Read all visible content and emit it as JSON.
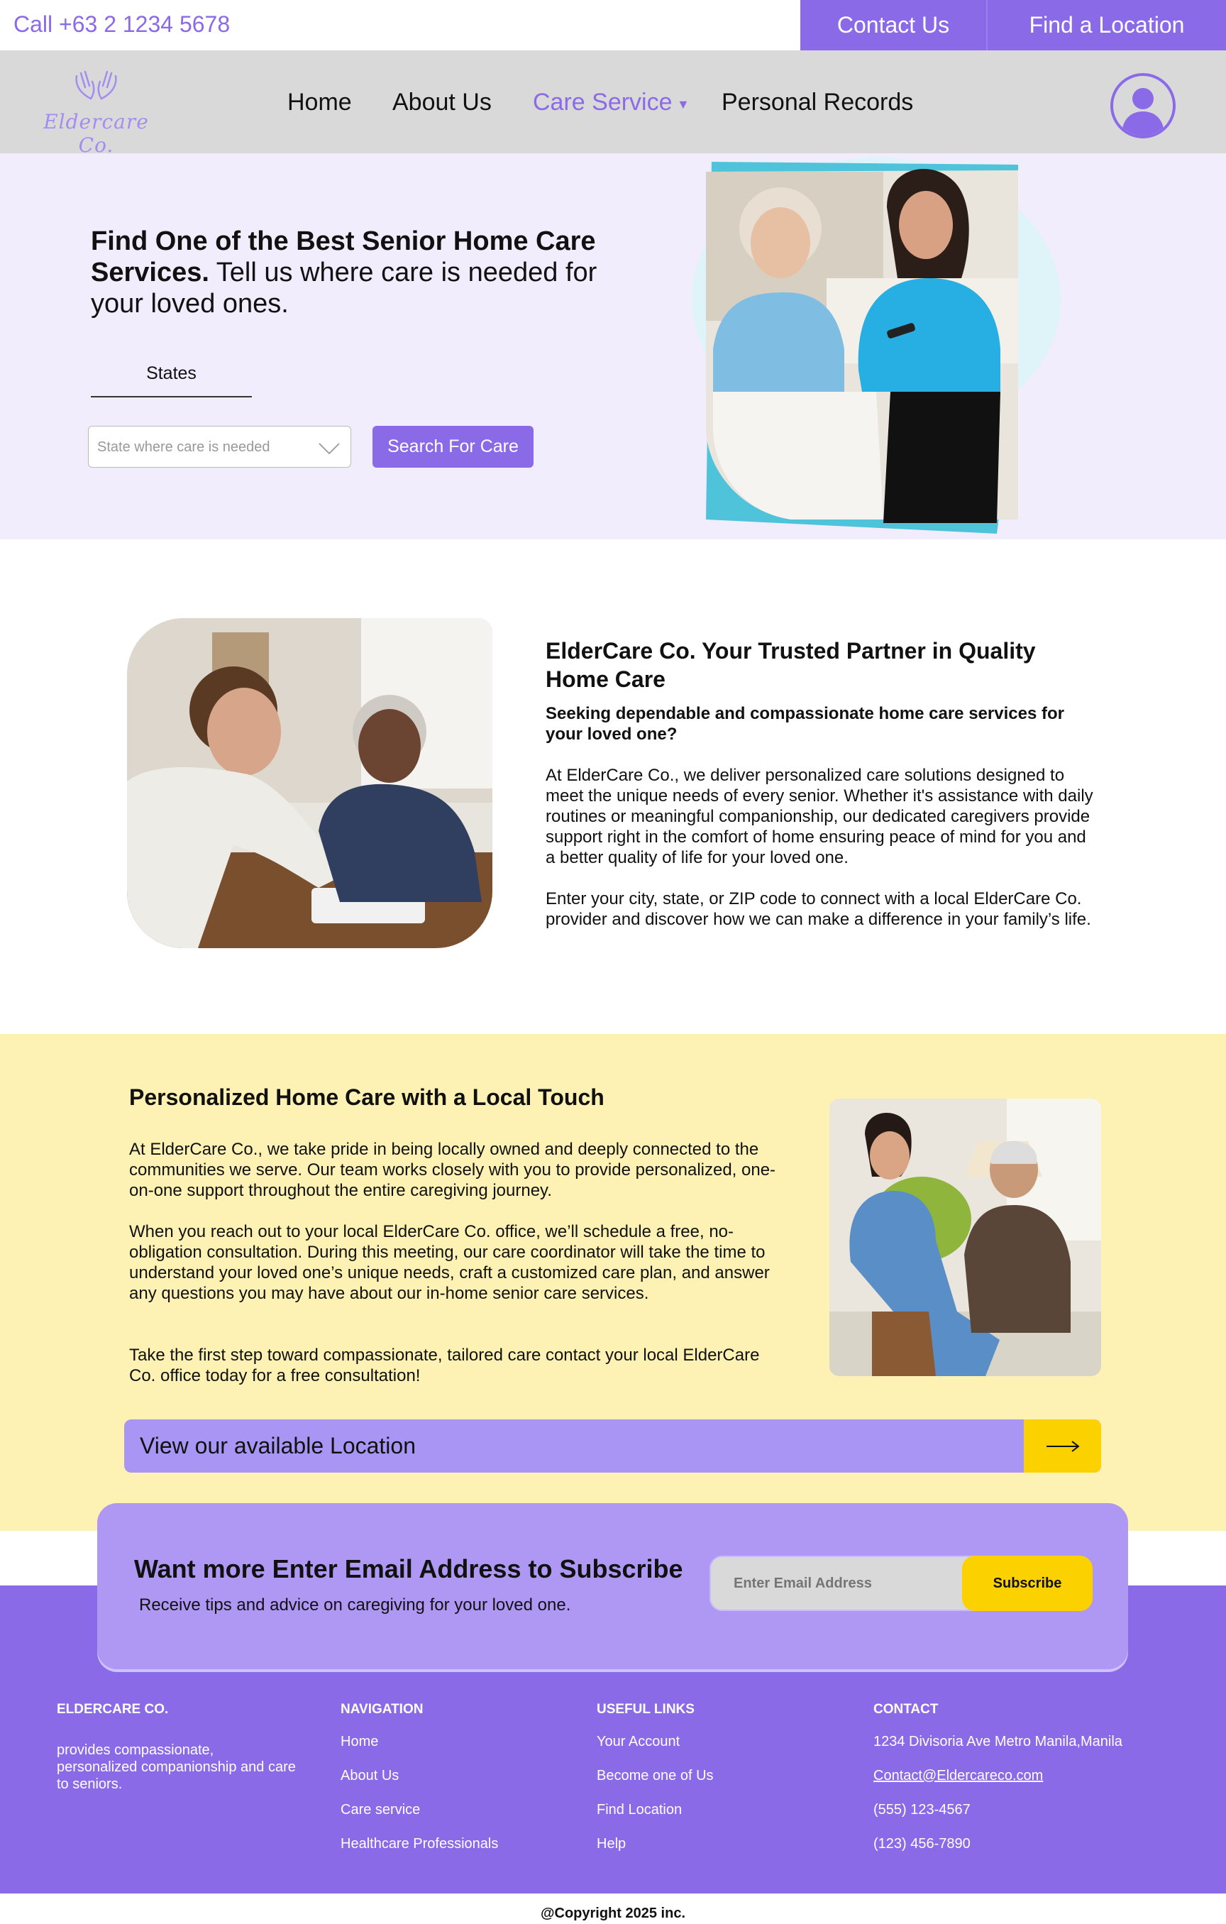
{
  "topbar": {
    "phone": "Call +63 2 1234 5678",
    "contact_label": "Contact Us",
    "location_label": "Find a Location"
  },
  "nav": {
    "logo_text": "Eldercare Co.",
    "links": [
      "Home",
      "About Us",
      "Care Service",
      "Personal Records"
    ],
    "active": "Care Service"
  },
  "hero": {
    "title_bold": "Find One of the Best Senior Home Care Services.",
    "title_rest": " Tell us where care is needed for your loved ones.",
    "tab_label": "States",
    "select_placeholder": "State where care is needed",
    "search_label": "Search For Care"
  },
  "about": {
    "title": "ElderCare Co. Your Trusted Partner in Quality Home Care",
    "subtitle": "Seeking dependable and compassionate home care services for your loved one?",
    "p1": "At ElderCare Co., we deliver personalized care solutions designed to meet the unique needs of every senior. Whether it's assistance with daily routines or meaningful companionship, our dedicated caregivers provide support right in the comfort of home ensuring peace of mind for you and a better quality of life for your loved one.",
    "p2": "Enter your city, state, or ZIP code to connect with a local ElderCare Co. provider and discover how we can make a difference in your family’s life."
  },
  "local": {
    "title": "Personalized Home Care with a Local Touch",
    "p1": "At ElderCare Co., we take pride in being locally owned and deeply connected to the communities we serve. Our team works closely with you to provide personalized, one-on-one support throughout the entire caregiving journey.",
    "p2": "When you reach out to your local ElderCare Co. office, we’ll schedule a free, no-obligation consultation. During this meeting, our care coordinator will take the time to understand your loved one’s unique needs, craft a customized care plan, and answer any questions you may have about our in-home senior care services.",
    "p3": "Take the first step toward compassionate, tailored care contact your local ElderCare Co. office today for a free consultation!",
    "location_bar_label": "View our available Location"
  },
  "subscribe": {
    "title": "Want more Enter Email Address to Subscribe",
    "text": "Receive tips and advice on caregiving for your loved one.",
    "placeholder": "Enter Email Address",
    "button": "Subscribe"
  },
  "footer": {
    "company_head": "ELDERCARE CO.",
    "company_desc": "provides compassionate, personalized companionship and care to seniors.",
    "nav_head": "NAVIGATION",
    "nav_links": [
      "Home",
      "About Us",
      "Care service",
      "Healthcare Professionals"
    ],
    "useful_head": "USEFUL LINKS",
    "useful_links": [
      "Your Account",
      "Become one of Us",
      "Find Location",
      "Help"
    ],
    "contact_head": "CONTACT",
    "address": "1234 Divisoria Ave Metro Manila,Manila",
    "email": "Contact@Eldercareco.com",
    "phone1": "(555) 123-4567",
    "phone2": "(123) 456-7890",
    "copyright": "@Copyright 2025 inc."
  },
  "colors": {
    "brand_purple": "#8b6ae8",
    "light_purple": "#a995f4",
    "yellow": "#fcd100",
    "cream": "#fdf1b3",
    "lavender": "#f1edfd"
  },
  "icons": [
    "hands-logo-icon",
    "user-avatar-icon",
    "chevron-down-icon",
    "arrow-right-icon"
  ]
}
